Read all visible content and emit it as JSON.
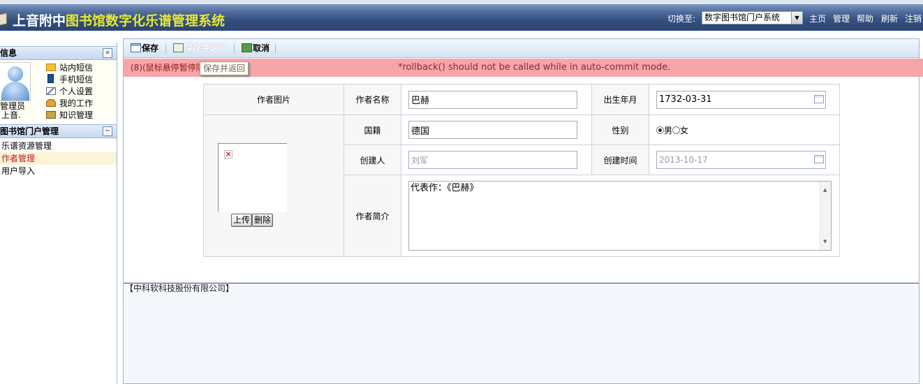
{
  "header": {
    "title_part1": "上音附中",
    "title_part2": "图书馆数字化乐谱管理系统",
    "switch_label": "切换至:",
    "system_select": "数字图书馆门户系统",
    "nav": [
      "主页",
      "管理",
      "帮助",
      "刷新",
      "注销"
    ]
  },
  "sidebar": {
    "info_title": "信息",
    "user_role": "管理员",
    "user_org": "上音.",
    "quick_links": [
      "站内短信",
      "手机短信",
      "个人设置",
      "我的工作",
      "知识管理"
    ],
    "nav_title": "图书馆门户管理",
    "menu_items": [
      "乐谱资源管理",
      "作者管理",
      "用户导入"
    ]
  },
  "toolbar": {
    "save_label": "保存",
    "save_back_label": "保存并返回",
    "cancel_label": "取消"
  },
  "error": {
    "hint": "(8)(鼠标悬停暂停隐",
    "message": "*rollback() should not be called while in auto-commit mode.",
    "tooltip": "保存并返回"
  },
  "form": {
    "photo_label": "作者图片",
    "name_label": "作者名称",
    "name_value": "巴赫",
    "birth_label": "出生年月",
    "birth_value": "1732-03-31",
    "nationality_label": "国籍",
    "nationality_value": "德国",
    "gender_label": "性别",
    "gender_male": "男",
    "gender_female": "女",
    "creator_label": "创建人",
    "creator_value": "刘军",
    "created_label": "创建时间",
    "created_value": "2013-10-17",
    "intro_label": "作者简介",
    "intro_value": "代表作：《巴赫》",
    "upload_label": "上传",
    "delete_label": "删除"
  },
  "footer": {
    "company": "【中科软科技股份有限公司】"
  },
  "colors": {
    "header_dark": "#2b4575",
    "title_accent": "#e8e830",
    "error_bg": "#f7a5a8",
    "menu_active": "#c2191c"
  }
}
